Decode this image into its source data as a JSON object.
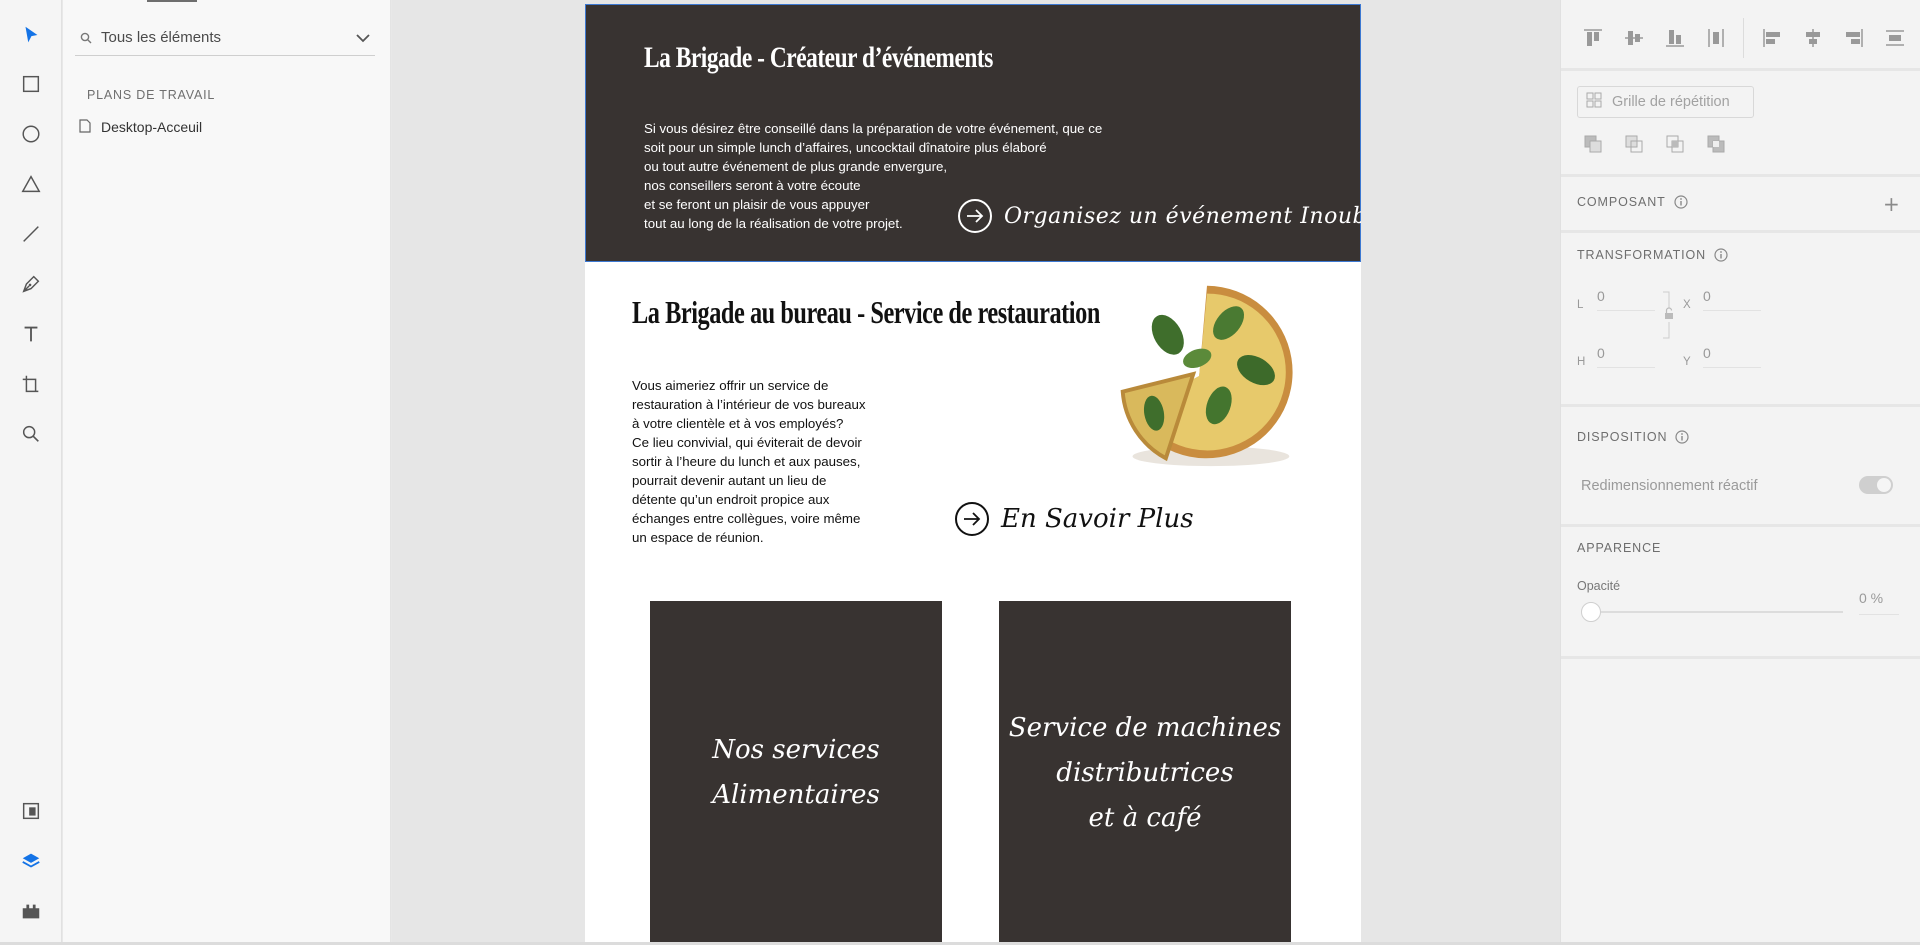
{
  "toolbar": {
    "tools": [
      "select-icon",
      "rectangle-icon",
      "ellipse-icon",
      "triangle-icon",
      "line-icon",
      "pen-icon",
      "text-icon",
      "artboard-icon",
      "zoom-icon"
    ],
    "bottom_tools": [
      "assets-icon",
      "layers-icon",
      "plugins-icon"
    ],
    "accent_color": "#1473e6"
  },
  "layers_panel": {
    "filter_label": "Tous les éléments",
    "section_title": "PLANS DE TRAVAIL",
    "artboards": [
      {
        "label": "Desktop-Acceuil"
      }
    ]
  },
  "artboard": {
    "hero": {
      "title": "La Brigade - Créateur d’événements",
      "body_lines": [
        "Si vous désirez être conseillé dans la préparation de votre événement, que ce",
        "soit pour un simple lunch d’affaires, uncocktail dînatoire plus élaboré",
        "ou tout autre événement de plus grande envergure,",
        "nos conseillers seront à votre écoute",
        "et se feront un plaisir de vous appuyer",
        "tout au long de la réalisation de votre projet."
      ],
      "cta": "Organisez un événement Inoubliable",
      "background": "#383331"
    },
    "section": {
      "title": "La Brigade au bureau - Service de restauration",
      "body_lines": [
        "Vous aimeriez offrir un service de",
        "restauration à l’intérieur de vos bureaux",
        "à votre clientèle et à vos employés?",
        "Ce lieu convivial, qui éviterait de devoir",
        "sortir à l’heure du lunch et aux pauses,",
        "pourrait devenir autant un lieu de",
        "détente qu’un endroit propice aux",
        "échanges entre collègues, voire même",
        "un espace de réunion."
      ],
      "cta": "En Savoir Plus"
    },
    "cards": [
      {
        "lines": [
          "Nos services",
          "Alimentaires"
        ]
      },
      {
        "lines": [
          "Service de machines",
          "distributrices",
          "et à café"
        ]
      }
    ]
  },
  "properties": {
    "repeat_grid": "Grille de répétition",
    "component_label": "COMPOSANT",
    "transform_label": "TRANSFORMATION",
    "fields": {
      "w_key": "L",
      "w_val": "0",
      "x_key": "X",
      "x_val": "0",
      "h_key": "H",
      "h_val": "0",
      "y_key": "Y",
      "y_val": "0"
    },
    "layout_label": "DISPOSITION",
    "responsive_label": "Redimensionnement réactif",
    "appearance_label": "APPARENCE",
    "opacity_label": "Opacité",
    "opacity_value": "0 %",
    "opacity_fraction": 0
  }
}
